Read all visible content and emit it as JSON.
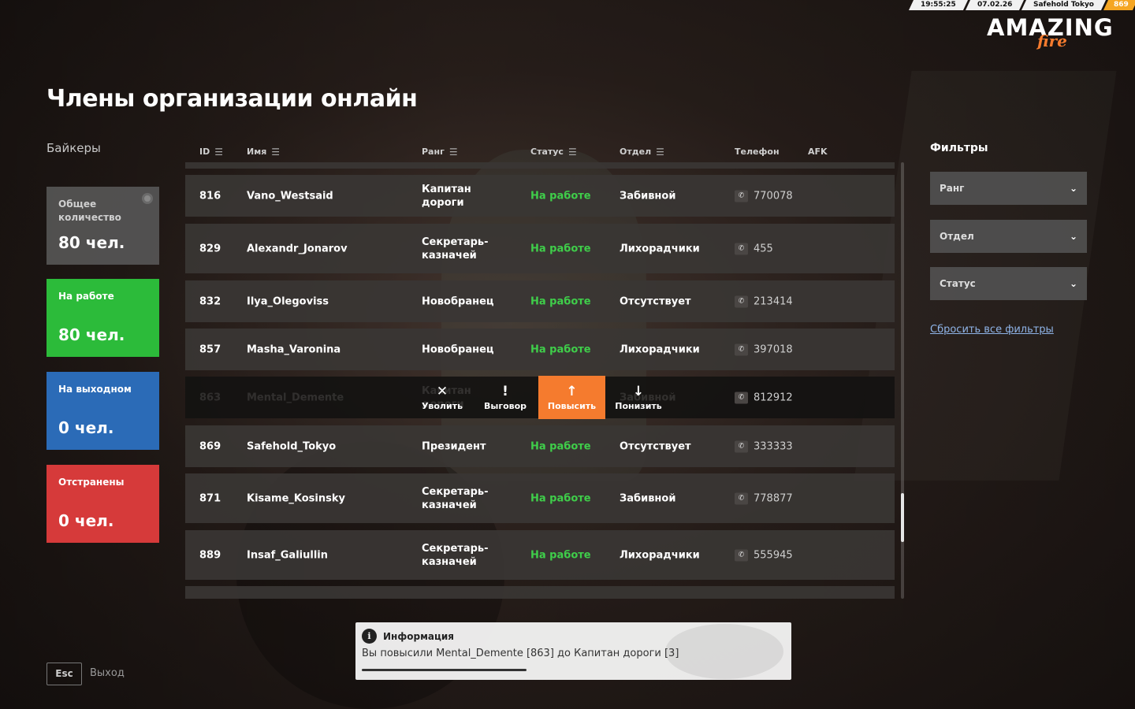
{
  "hud": {
    "time": "19:55:25",
    "date": "07.02.26",
    "player": "Safehold Tokyo",
    "player_id": "869"
  },
  "logo": {
    "main": "AMAZING",
    "sub": "fire"
  },
  "page": {
    "title": "Члены организации онлайн",
    "org_name": "Байкеры"
  },
  "stats": [
    {
      "label": "Общее количество",
      "value": "80 чел.",
      "color": "#5a5a5a"
    },
    {
      "label": "На работе",
      "value": "80 чел.",
      "color": "#2cbb3a"
    },
    {
      "label": "На выходном",
      "value": "0 чел.",
      "color": "#2b6bb7"
    },
    {
      "label": "Отстранены",
      "value": "0 чел.",
      "color": "#d63a3a"
    }
  ],
  "table": {
    "headers": {
      "id": "ID",
      "name": "Имя",
      "rank": "Ранг",
      "status": "Статус",
      "dept": "Отдел",
      "phone": "Телефон",
      "afk": "AFK"
    },
    "rows": [
      {
        "id": "816",
        "name": "Vano_Westsaid",
        "rank": "Капитан дороги",
        "status": "На работе",
        "dept": "Забивной",
        "phone": "770078"
      },
      {
        "id": "829",
        "name": "Alexandr_Jonarov",
        "rank": "Секретарь-казначей",
        "status": "На работе",
        "dept": "Лихорадчики",
        "phone": "455"
      },
      {
        "id": "832",
        "name": "Ilya_Olegoviss",
        "rank": "Новобранец",
        "status": "На работе",
        "dept": "Отсутствует",
        "phone": "213414"
      },
      {
        "id": "857",
        "name": "Masha_Varonina",
        "rank": "Новобранец",
        "status": "На работе",
        "dept": "Лихорадчики",
        "phone": "397018"
      },
      {
        "id": "863",
        "name": "Mental_Demente",
        "rank": "Капитан дороги",
        "status": "",
        "dept": "Забивной",
        "phone": "812912"
      },
      {
        "id": "869",
        "name": "Safehold_Tokyo",
        "rank": "Президент",
        "status": "На работе",
        "dept": "Отсутствует",
        "phone": "333333"
      },
      {
        "id": "871",
        "name": "Kisame_Kosinsky",
        "rank": "Секретарь-казначей",
        "status": "На работе",
        "dept": "Забивной",
        "phone": "778877"
      },
      {
        "id": "889",
        "name": "Insaf_Galiullin",
        "rank": "Секретарь-казначей",
        "status": "На работе",
        "dept": "Лихорадчики",
        "phone": "555945"
      }
    ]
  },
  "actions": {
    "fire": "Уволить",
    "reprimand": "Выговор",
    "promote": "Повысить",
    "demote": "Понизить"
  },
  "filters": {
    "title": "Фильтры",
    "rank": "Ранг",
    "dept": "Отдел",
    "status": "Статус",
    "reset": "Сбросить все фильтры"
  },
  "toast": {
    "title": "Информация",
    "message": "Вы повысили Mental_Demente [863] до Капитан дороги [3]"
  },
  "footer": {
    "esc_key": "Esc",
    "esc_label": "Выход"
  }
}
